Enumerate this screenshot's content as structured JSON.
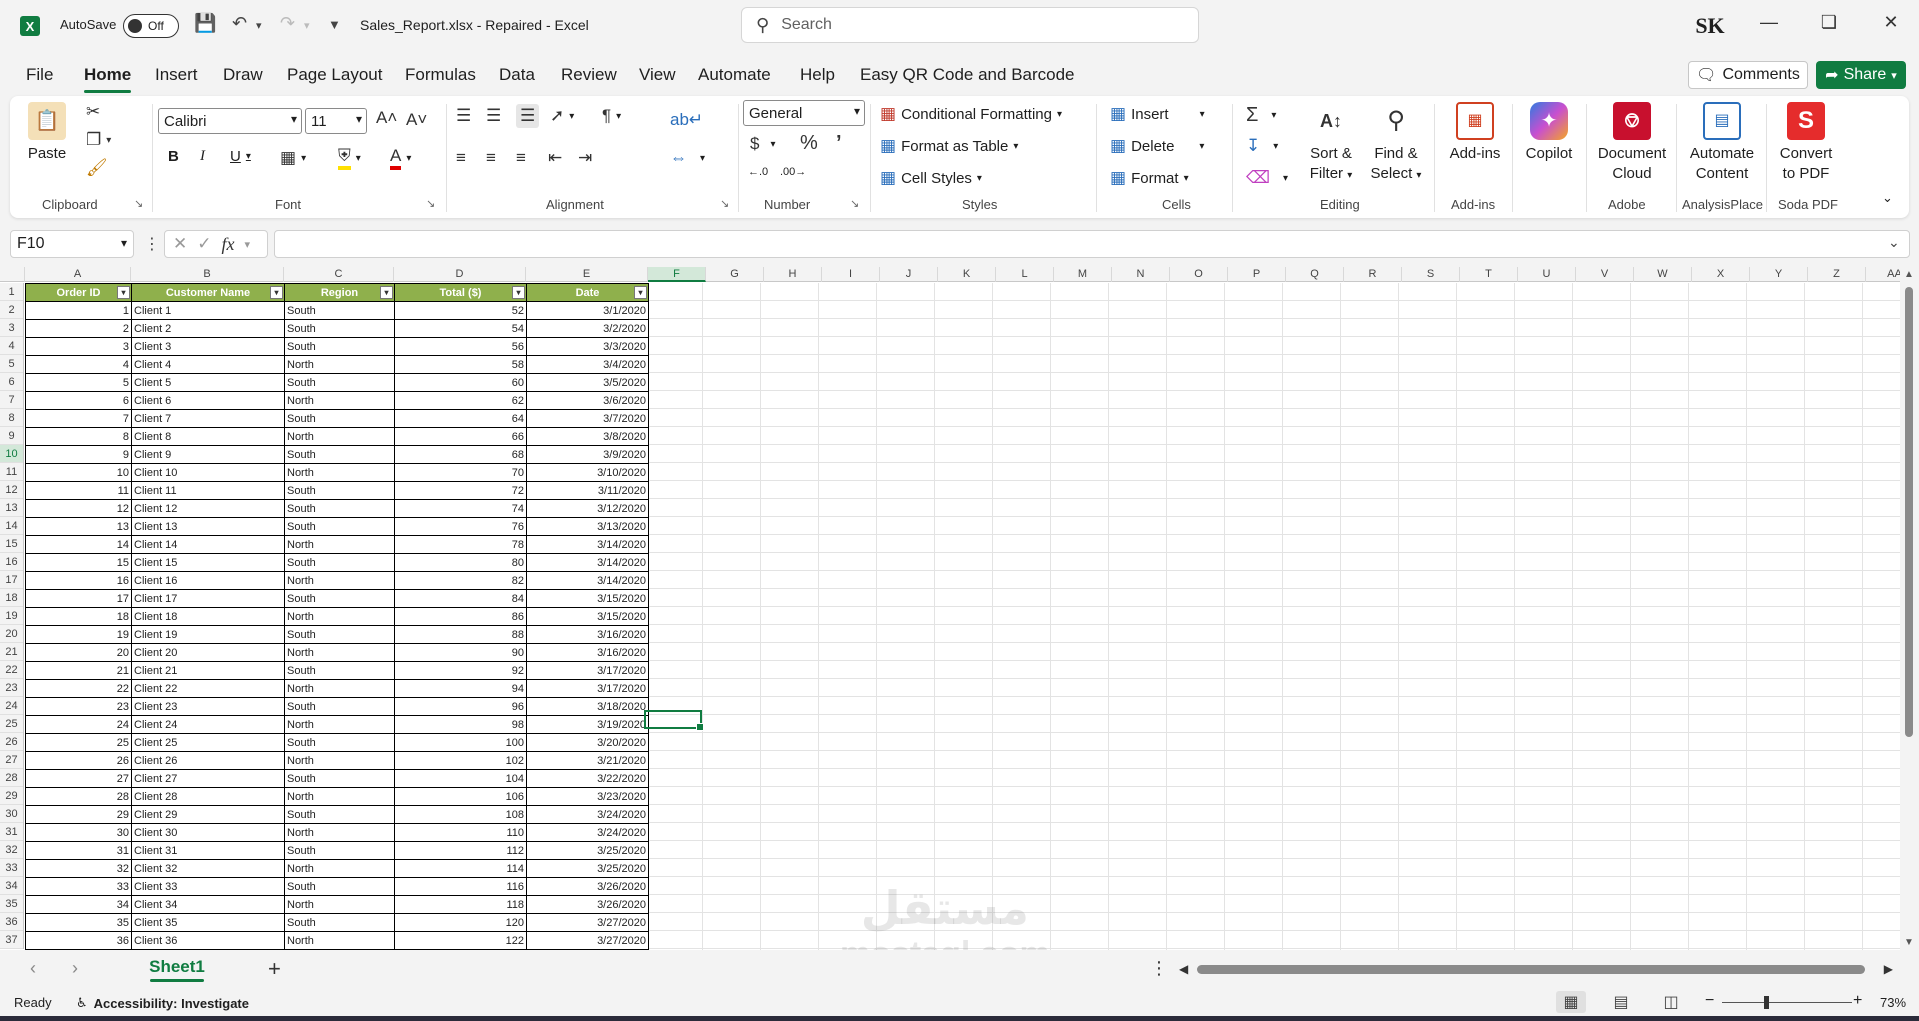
{
  "titlebar": {
    "autosave_label": "AutoSave",
    "autosave_state": "Off",
    "document_title": "Sales_Report.xlsx  -  Repaired  -  Excel",
    "search_placeholder": "Search",
    "user_initials": "SK"
  },
  "tabs": [
    "File",
    "Home",
    "Insert",
    "Draw",
    "Page Layout",
    "Formulas",
    "Data",
    "Review",
    "View",
    "Automate",
    "Help",
    "Easy QR Code and Barcode"
  ],
  "active_tab": "Home",
  "actions": {
    "comments": "Comments",
    "share": "Share"
  },
  "ribbon": {
    "clipboard": {
      "paste": "Paste",
      "label": "Clipboard"
    },
    "font": {
      "name": "Calibri",
      "size": "11",
      "label": "Font"
    },
    "alignment": {
      "label": "Alignment"
    },
    "number": {
      "format": "General",
      "label": "Number"
    },
    "styles": {
      "conditional": "Conditional Formatting",
      "format_table": "Format as Table",
      "cell_styles": "Cell Styles",
      "label": "Styles"
    },
    "cells": {
      "insert": "Insert",
      "delete": "Delete",
      "format": "Format",
      "label": "Cells"
    },
    "editing": {
      "sort1": "Sort &",
      "sort2": "Filter",
      "find1": "Find &",
      "find2": "Select",
      "label": "Editing"
    },
    "addins": {
      "addins": "Add-ins",
      "label": "Add-ins"
    },
    "copilot": {
      "copilot": "Copilot"
    },
    "adobe": {
      "line1": "Document",
      "line2": "Cloud",
      "label": "Adobe"
    },
    "analysisplace": {
      "line1": "Automate",
      "line2": "Content",
      "label": "AnalysisPlace"
    },
    "sodapdf": {
      "line1": "Convert",
      "line2": "to PDF",
      "label": "Soda PDF"
    }
  },
  "formula_bar": {
    "name_box": "F10",
    "fx": "fx",
    "formula": ""
  },
  "columns": [
    "A",
    "B",
    "C",
    "D",
    "E",
    "F",
    "G",
    "H",
    "I",
    "J",
    "K",
    "L",
    "M",
    "N",
    "O",
    "P",
    "Q",
    "R",
    "S",
    "T",
    "U",
    "V",
    "W",
    "X",
    "Y",
    "Z",
    "AA"
  ],
  "selected_column": "F",
  "selected_row": 10,
  "table": {
    "headers": [
      "Order ID",
      "Customer Name",
      "Region",
      "Total ($)",
      "Date"
    ],
    "rows": [
      [
        1,
        "Client 1",
        "South",
        52,
        "3/1/2020"
      ],
      [
        2,
        "Client 2",
        "South",
        54,
        "3/2/2020"
      ],
      [
        3,
        "Client 3",
        "South",
        56,
        "3/3/2020"
      ],
      [
        4,
        "Client 4",
        "North",
        58,
        "3/4/2020"
      ],
      [
        5,
        "Client 5",
        "South",
        60,
        "3/5/2020"
      ],
      [
        6,
        "Client 6",
        "North",
        62,
        "3/6/2020"
      ],
      [
        7,
        "Client 7",
        "South",
        64,
        "3/7/2020"
      ],
      [
        8,
        "Client 8",
        "North",
        66,
        "3/8/2020"
      ],
      [
        9,
        "Client 9",
        "South",
        68,
        "3/9/2020"
      ],
      [
        10,
        "Client 10",
        "North",
        70,
        "3/10/2020"
      ],
      [
        11,
        "Client 11",
        "South",
        72,
        "3/11/2020"
      ],
      [
        12,
        "Client 12",
        "South",
        74,
        "3/12/2020"
      ],
      [
        13,
        "Client 13",
        "South",
        76,
        "3/13/2020"
      ],
      [
        14,
        "Client 14",
        "North",
        78,
        "3/14/2020"
      ],
      [
        15,
        "Client 15",
        "South",
        80,
        "3/14/2020"
      ],
      [
        16,
        "Client 16",
        "North",
        82,
        "3/14/2020"
      ],
      [
        17,
        "Client 17",
        "South",
        84,
        "3/15/2020"
      ],
      [
        18,
        "Client 18",
        "North",
        86,
        "3/15/2020"
      ],
      [
        19,
        "Client 19",
        "South",
        88,
        "3/16/2020"
      ],
      [
        20,
        "Client 20",
        "North",
        90,
        "3/16/2020"
      ],
      [
        21,
        "Client 21",
        "South",
        92,
        "3/17/2020"
      ],
      [
        22,
        "Client 22",
        "North",
        94,
        "3/17/2020"
      ],
      [
        23,
        "Client 23",
        "South",
        96,
        "3/18/2020"
      ],
      [
        24,
        "Client 24",
        "North",
        98,
        "3/19/2020"
      ],
      [
        25,
        "Client 25",
        "South",
        100,
        "3/20/2020"
      ],
      [
        26,
        "Client 26",
        "North",
        102,
        "3/21/2020"
      ],
      [
        27,
        "Client 27",
        "South",
        104,
        "3/22/2020"
      ],
      [
        28,
        "Client 28",
        "North",
        106,
        "3/23/2020"
      ],
      [
        29,
        "Client 29",
        "South",
        108,
        "3/24/2020"
      ],
      [
        30,
        "Client 30",
        "North",
        110,
        "3/24/2020"
      ],
      [
        31,
        "Client 31",
        "South",
        112,
        "3/25/2020"
      ],
      [
        32,
        "Client 32",
        "North",
        114,
        "3/25/2020"
      ],
      [
        33,
        "Client 33",
        "South",
        116,
        "3/26/2020"
      ],
      [
        34,
        "Client 34",
        "North",
        118,
        "3/26/2020"
      ],
      [
        35,
        "Client 35",
        "South",
        120,
        "3/27/2020"
      ],
      [
        36,
        "Client 36",
        "North",
        122,
        "3/27/2020"
      ]
    ]
  },
  "sheets": [
    "Sheet1"
  ],
  "status": {
    "ready": "Ready",
    "accessibility": "Accessibility: Investigate",
    "zoom": "73%"
  },
  "colors": {
    "accent": "#107c41",
    "header_fill": "#8fb04c"
  },
  "watermark": "مستقل mostaql.com"
}
